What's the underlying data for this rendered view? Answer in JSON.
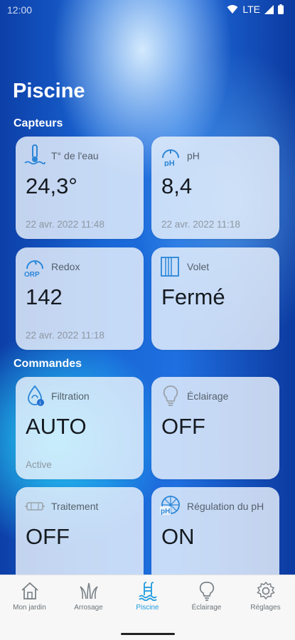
{
  "status": {
    "time": "12:00",
    "network": "LTE"
  },
  "title": "Piscine",
  "sections": {
    "sensors": "Capteurs",
    "controls": "Commandes"
  },
  "sensors": [
    {
      "label": "T° de l'eau",
      "value": "24,3°",
      "timestamp": "22 avr. 2022 11:48",
      "icon": "thermometer-water-icon"
    },
    {
      "label": "pH",
      "value": "8,4",
      "timestamp": "22 avr. 2022 11:18",
      "icon": "ph-gauge-icon"
    },
    {
      "label": "Redox",
      "value": "142",
      "timestamp": "22 avr. 2022 11:18",
      "icon": "orp-gauge-icon"
    },
    {
      "label": "Volet",
      "value": "Fermé",
      "timestamp": "",
      "icon": "shutter-icon"
    }
  ],
  "controls": [
    {
      "label": "Filtration",
      "value": "AUTO",
      "status": "Active",
      "icon": "filtration-icon"
    },
    {
      "label": "Éclairage",
      "value": "OFF",
      "status": "",
      "icon": "bulb-icon"
    },
    {
      "label": "Traitement",
      "value": "OFF",
      "status": "",
      "icon": "treatment-icon"
    },
    {
      "label": "Régulation du pH",
      "value": "ON",
      "status": "",
      "icon": "ph-regulation-icon"
    }
  ],
  "nav": [
    {
      "label": "Mon jardin",
      "icon": "home-icon",
      "active": false
    },
    {
      "label": "Arrosage",
      "icon": "grass-icon",
      "active": false
    },
    {
      "label": "Piscine",
      "icon": "pool-icon",
      "active": true
    },
    {
      "label": "Éclairage",
      "icon": "bulb-icon",
      "active": false
    },
    {
      "label": "Réglages",
      "icon": "gear-icon",
      "active": false
    }
  ],
  "colors": {
    "accent": "#1e9be0",
    "icon": "#2a86d8"
  }
}
